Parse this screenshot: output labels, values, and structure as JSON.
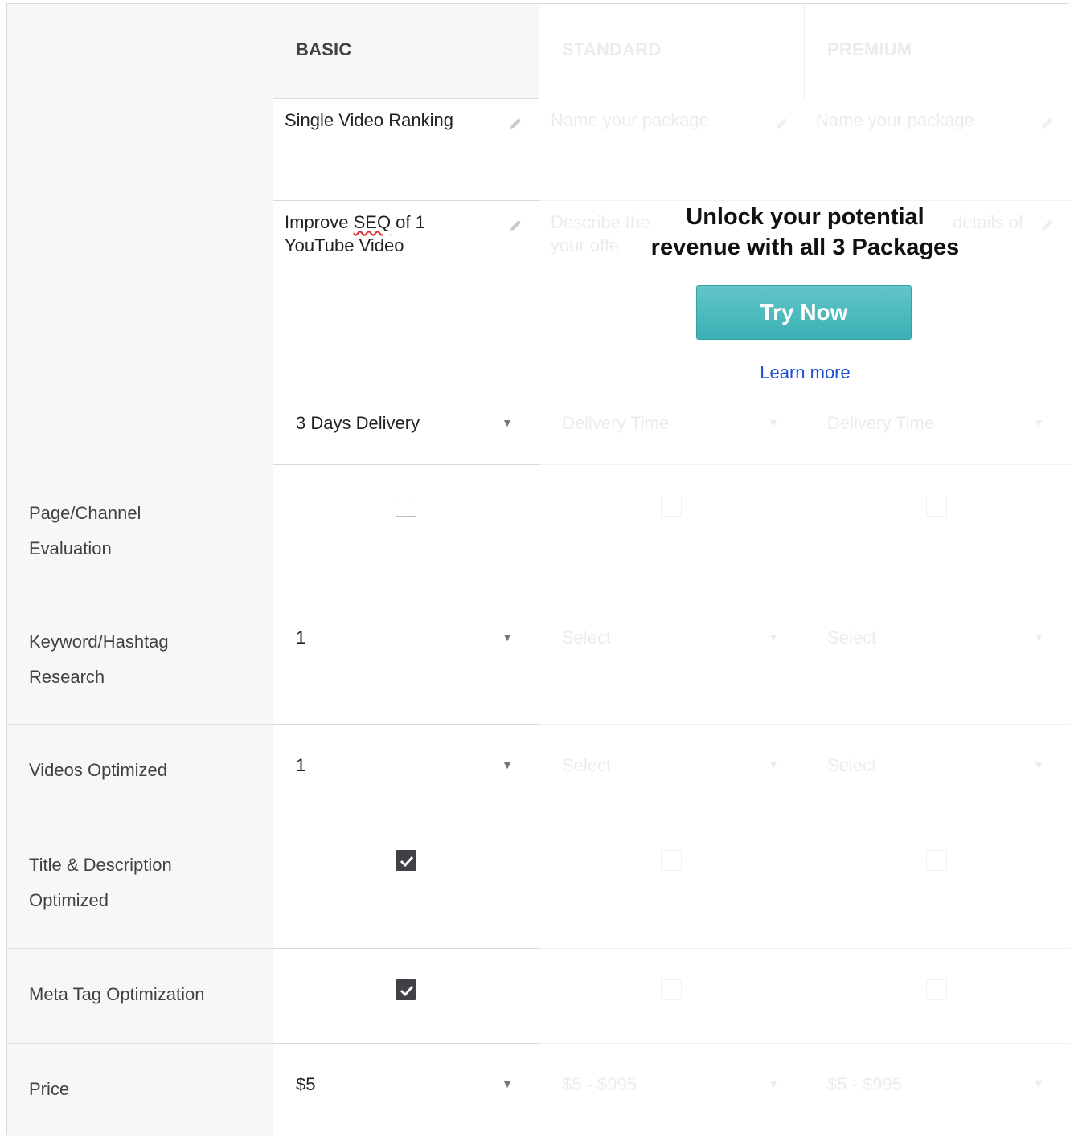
{
  "headers": {
    "basic": "BASIC",
    "standard": "STANDARD",
    "premium": "PREMIUM"
  },
  "name_row": {
    "basic": "Single Video Ranking",
    "standard_placeholder": "Name your package",
    "premium_placeholder": "Name your package"
  },
  "desc_row": {
    "basic_part1": "Improve ",
    "basic_misspelled": "SEQ",
    "basic_part2": " of 1 YouTube Video",
    "standard_placeholder_a": "Describe the ",
    "standard_placeholder_b": "your offe",
    "premium_placeholder_a": "details of"
  },
  "delivery_row": {
    "basic": "3 Days Delivery",
    "standard": "Delivery Time",
    "premium": "Delivery Time"
  },
  "rows": {
    "page_channel": {
      "label_line1": "Page/Channel",
      "label_line2": "Evaluation",
      "basic_checked": false
    },
    "keyword": {
      "label_line1": "Keyword/Hashtag",
      "label_line2": "Research",
      "basic": "1",
      "standard": "Select",
      "premium": "Select"
    },
    "videos": {
      "label": "Videos Optimized",
      "basic": "1",
      "standard": "Select",
      "premium": "Select"
    },
    "title_desc": {
      "label_line1": "Title & Description",
      "label_line2": "Optimized",
      "basic_checked": true
    },
    "meta_tag": {
      "label": "Meta Tag Optimization",
      "basic_checked": true
    },
    "price": {
      "label": "Price",
      "basic": "$5",
      "standard": "$5 - $995",
      "premium": "$5 - $995"
    }
  },
  "overlay": {
    "title_line1": "Unlock your potential",
    "title_line2": "revenue with all 3 Packages",
    "button": "Try Now",
    "link": "Learn more"
  },
  "colors": {
    "accent": "#3ab1b5",
    "link": "#1d4ed8",
    "check": "#404145"
  }
}
